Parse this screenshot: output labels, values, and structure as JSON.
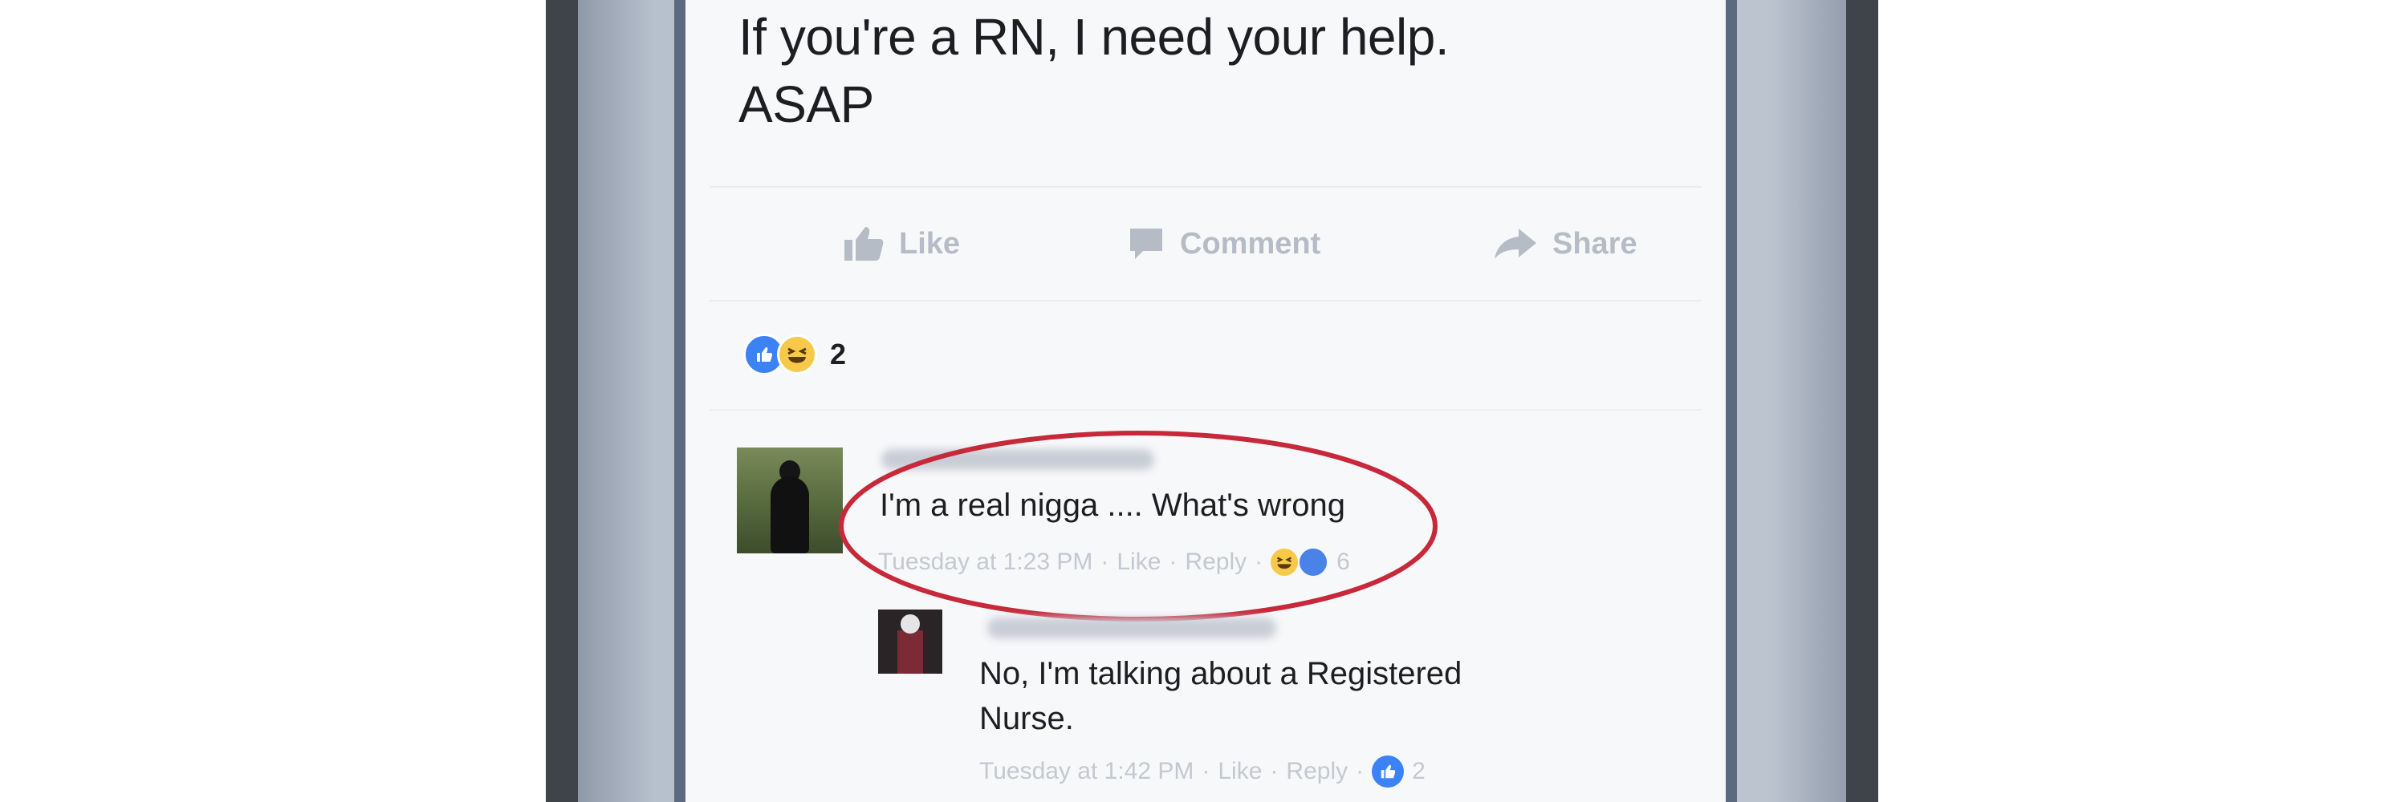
{
  "post": {
    "text_line1": "If you're a RN, I need your help.",
    "text_line2": "ASAP"
  },
  "actions": {
    "like": "Like",
    "comment": "Comment",
    "share": "Share"
  },
  "reactions": {
    "icons": [
      "like-reaction-icon",
      "haha-reaction-icon"
    ],
    "count": "2"
  },
  "comments": [
    {
      "text": "I'm a real nigga .... What's wrong",
      "time": "Tuesday at 1:23 PM",
      "like_label": "Like",
      "reply_label": "Reply",
      "reaction_count": "6",
      "reaction_icons": [
        "haha-reaction-icon",
        "like-reaction-icon"
      ],
      "highlight_color": "#c7283a"
    },
    {
      "text_line1": "No, I'm talking about a Registered",
      "text_line2": "Nurse.",
      "time": "Tuesday at 1:42 PM",
      "like_label": "Like",
      "reply_label": "Reply",
      "reaction_count": "2",
      "reaction_icons": [
        "like-reaction-icon"
      ]
    }
  ],
  "colors": {
    "accent": "#3b82f6",
    "muted_text": "#b6bcc6",
    "highlight_ring": "#c7283a"
  }
}
